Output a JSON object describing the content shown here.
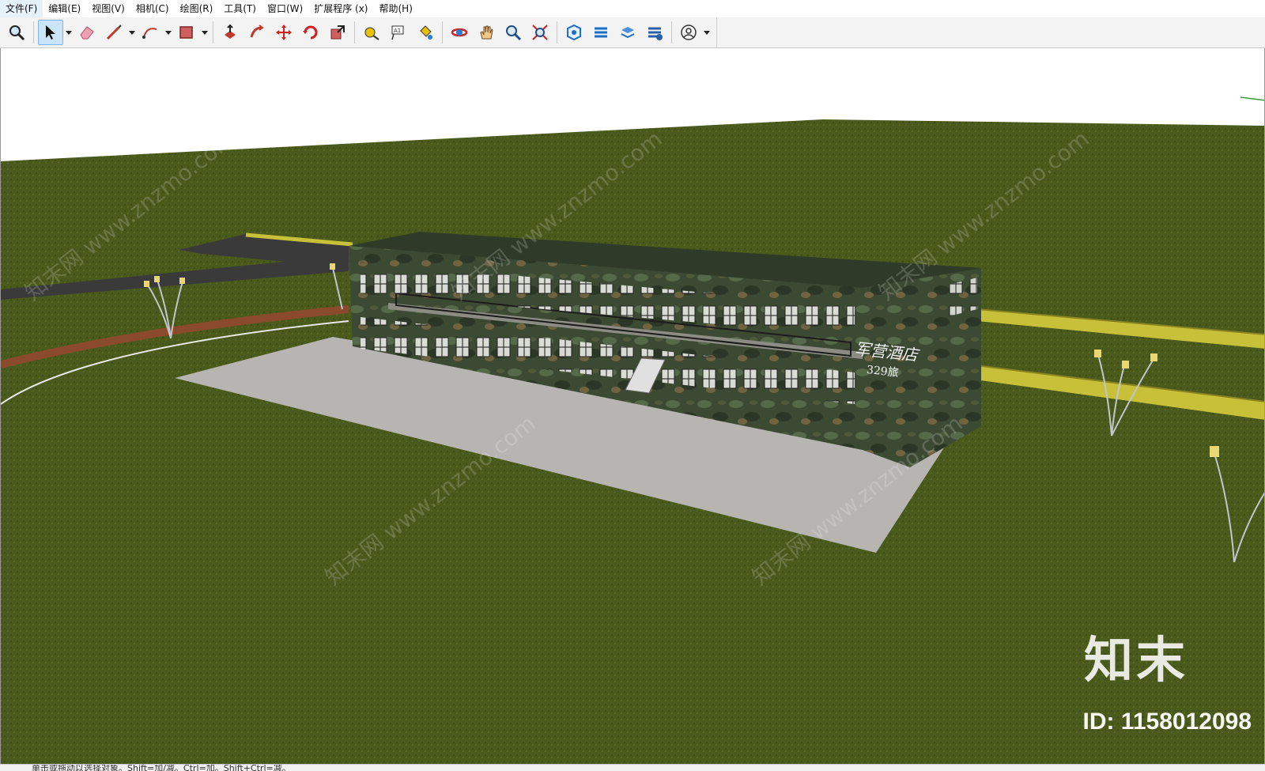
{
  "menu": {
    "items": [
      {
        "label": "文件(F)"
      },
      {
        "label": "编辑(E)"
      },
      {
        "label": "视图(V)"
      },
      {
        "label": "相机(C)"
      },
      {
        "label": "绘图(R)"
      },
      {
        "label": "工具(T)"
      },
      {
        "label": "窗口(W)"
      },
      {
        "label": "扩展程序 (x)"
      },
      {
        "label": "帮助(H)"
      }
    ]
  },
  "toolbar": {
    "tools": [
      {
        "icon": "zoom-icon"
      },
      {
        "icon": "select-arrow-icon",
        "active": true
      },
      {
        "icon": "eraser-icon"
      },
      {
        "icon": "pencil-line-icon"
      },
      {
        "icon": "arc-icon"
      },
      {
        "icon": "rectangle-shape-icon"
      },
      {
        "icon": "push-pull-icon"
      },
      {
        "icon": "follow-me-icon"
      },
      {
        "icon": "move-icon"
      },
      {
        "icon": "rotate-icon"
      },
      {
        "icon": "scale-icon"
      },
      {
        "icon": "tape-measure-icon"
      },
      {
        "icon": "text-icon"
      },
      {
        "icon": "paint-bucket-icon"
      },
      {
        "icon": "orbit-icon"
      },
      {
        "icon": "pan-hand-icon"
      },
      {
        "icon": "zoom-magnifier-icon"
      },
      {
        "icon": "zoom-extents-icon"
      },
      {
        "icon": "3d-warehouse-icon"
      },
      {
        "icon": "extension-warehouse-icon"
      },
      {
        "icon": "layout-icon"
      },
      {
        "icon": "extension-manager-icon"
      },
      {
        "icon": "account-icon"
      }
    ]
  },
  "scene": {
    "building_sign": {
      "name": "军营酒店",
      "number": "329旅"
    }
  },
  "watermark": {
    "logo": "知末",
    "id": "ID: 1158012098",
    "text": "知末网 www.znzmo.com"
  },
  "status": {
    "text": "单击或拖动以选择对象。Shift=加/减。Ctrl=加。Shift+Ctrl=减。"
  },
  "colors": {
    "grass": "#4a5a1c",
    "sky": "#ffffff",
    "road": "#3a3a3a",
    "road_stripe": "#c9c03a",
    "plaza": "#b7b5b2",
    "building": "#3d4a33",
    "selection": "#cce4f7"
  }
}
